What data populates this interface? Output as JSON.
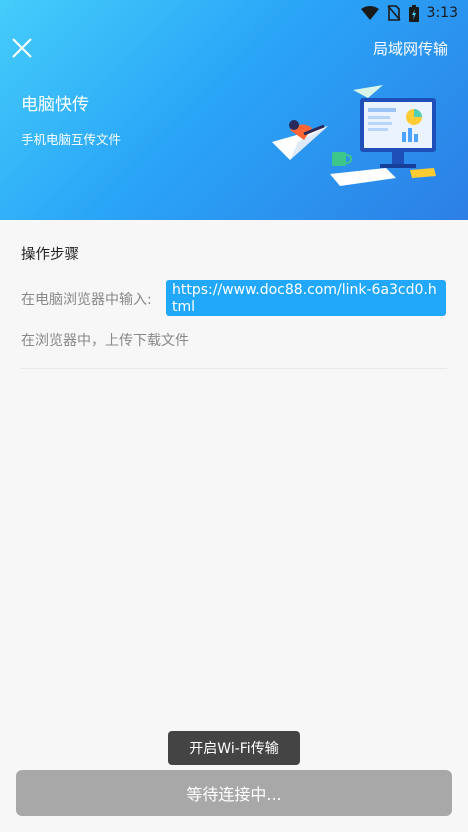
{
  "status_bar": {
    "time": "3:13",
    "icons": [
      "wifi-icon",
      "no-sim-icon",
      "battery-charging-icon"
    ]
  },
  "header": {
    "close_icon": "close-icon",
    "lan_button_label": "局域网传输",
    "title": "电脑快传",
    "subtitle": "手机电脑互传文件",
    "illustration": "computer-transfer-illustration"
  },
  "steps": {
    "title": "操作步骤",
    "step1_label": "在电脑浏览器中输入:",
    "url": "https://www.doc88.com/link-6a3cd0.html",
    "step2_label": "在浏览器中，上传下载文件"
  },
  "toast": {
    "text": "开启Wi-Fi传输"
  },
  "bottom": {
    "wait_button_label": "等待连接中..."
  },
  "colors": {
    "header_gradient_start": "#45cdfa",
    "header_gradient_end": "#2c7fe6",
    "url_highlight": "#22a8fb",
    "wait_button": "#a8a8a8",
    "toast_bg": "#444444"
  }
}
